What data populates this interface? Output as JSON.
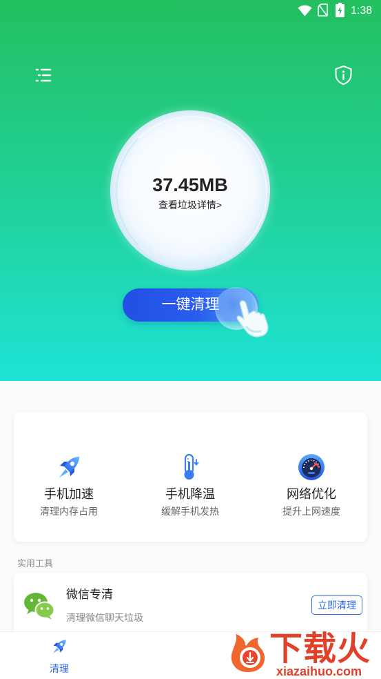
{
  "status_bar": {
    "time": "1:38",
    "icons": [
      "wifi-icon",
      "sim-icon",
      "battery-charging-icon"
    ]
  },
  "header": {
    "menu_icon": "list-icon",
    "info_icon": "shield-info-icon"
  },
  "scan": {
    "junk_size": "37.45MB",
    "details_link": "查看垃圾详情>",
    "clean_button": "一键清理"
  },
  "features": [
    {
      "icon": "rocket-icon",
      "title": "手机加速",
      "subtitle": "清理内存占用"
    },
    {
      "icon": "thermometer-icon",
      "title": "手机降温",
      "subtitle": "缓解手机发热"
    },
    {
      "icon": "speedometer-icon",
      "title": "网络优化",
      "subtitle": "提升上网速度"
    }
  ],
  "tools": {
    "section_label": "实用工具",
    "items": [
      {
        "icon": "wechat-icon",
        "title": "微信专清",
        "subtitle": "清理微信聊天垃圾",
        "action": "立即清理"
      }
    ]
  },
  "bottom_nav": {
    "items": [
      {
        "icon": "rocket-icon",
        "label": "清理",
        "active": true
      }
    ]
  },
  "watermark": {
    "brand": "下载火",
    "domain": "xiazaihuo.com"
  },
  "colors": {
    "header_top": "#23bf5f",
    "header_bottom": "#1fe3d6",
    "accent_blue": "#2d6be8",
    "button_blue": "#2150e3",
    "watermark_red": "#e0412a"
  }
}
